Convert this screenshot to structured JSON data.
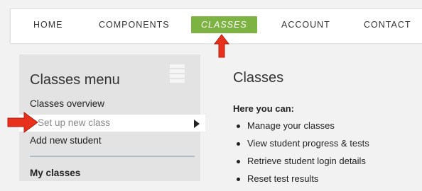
{
  "nav": {
    "items": [
      {
        "label": "HOME",
        "active": false
      },
      {
        "label": "COMPONENTS",
        "active": false
      },
      {
        "label": "CLASSES",
        "active": true
      },
      {
        "label": "ACCOUNT",
        "active": false
      },
      {
        "label": "CONTACT",
        "active": false
      }
    ]
  },
  "sidebar": {
    "title": "Classes menu",
    "links": [
      "Classes overview",
      "Set up new class",
      "Add new student"
    ],
    "section_heading": "My classes"
  },
  "main": {
    "title": "Classes",
    "subtitle": "Here you can:",
    "bullets": [
      "Manage your classes",
      "View student progress & tests",
      "Retrieve student login details",
      "Reset test results"
    ]
  },
  "colors": {
    "active_nav": "#7cb342",
    "annotation_arrow": "#e8311c",
    "panel_bg": "#e3e3e3"
  }
}
